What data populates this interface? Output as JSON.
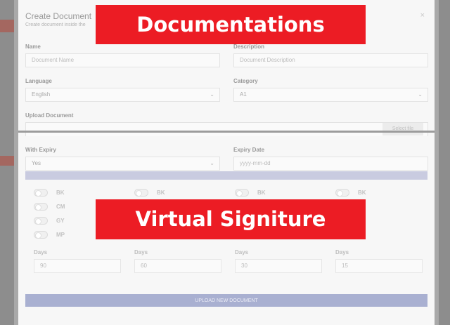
{
  "modal": {
    "title": "Create Document",
    "subtitle": "Create document inside the",
    "close_label": "×"
  },
  "form": {
    "name": {
      "label": "Name",
      "placeholder": "Document Name"
    },
    "description": {
      "label": "Description",
      "placeholder": "Document Description"
    },
    "language": {
      "label": "Language",
      "value": "English"
    },
    "category": {
      "label": "Category",
      "value": "A1"
    },
    "upload": {
      "label": "Upload Document",
      "button": "Select file"
    },
    "expiry": {
      "label": "With Expiry",
      "value": "Yes"
    },
    "expiry_date": {
      "label": "Expiry Date",
      "placeholder": "yyyy-mm-dd"
    }
  },
  "signatures": {
    "col1": [
      "BK",
      "CM",
      "GY",
      "MP"
    ],
    "col2": [
      "BK"
    ],
    "col3": [
      "BK"
    ],
    "col4": [
      "BK"
    ]
  },
  "days": [
    {
      "label": "Days",
      "value": "90"
    },
    {
      "label": "Days",
      "value": "60"
    },
    {
      "label": "Days",
      "value": "30"
    },
    {
      "label": "Days",
      "value": "15"
    }
  ],
  "actions": {
    "upload": "UPLOAD NEW DOCUMENT"
  },
  "banners": {
    "top": "Documentations",
    "middle": "Virtual Signiture"
  }
}
